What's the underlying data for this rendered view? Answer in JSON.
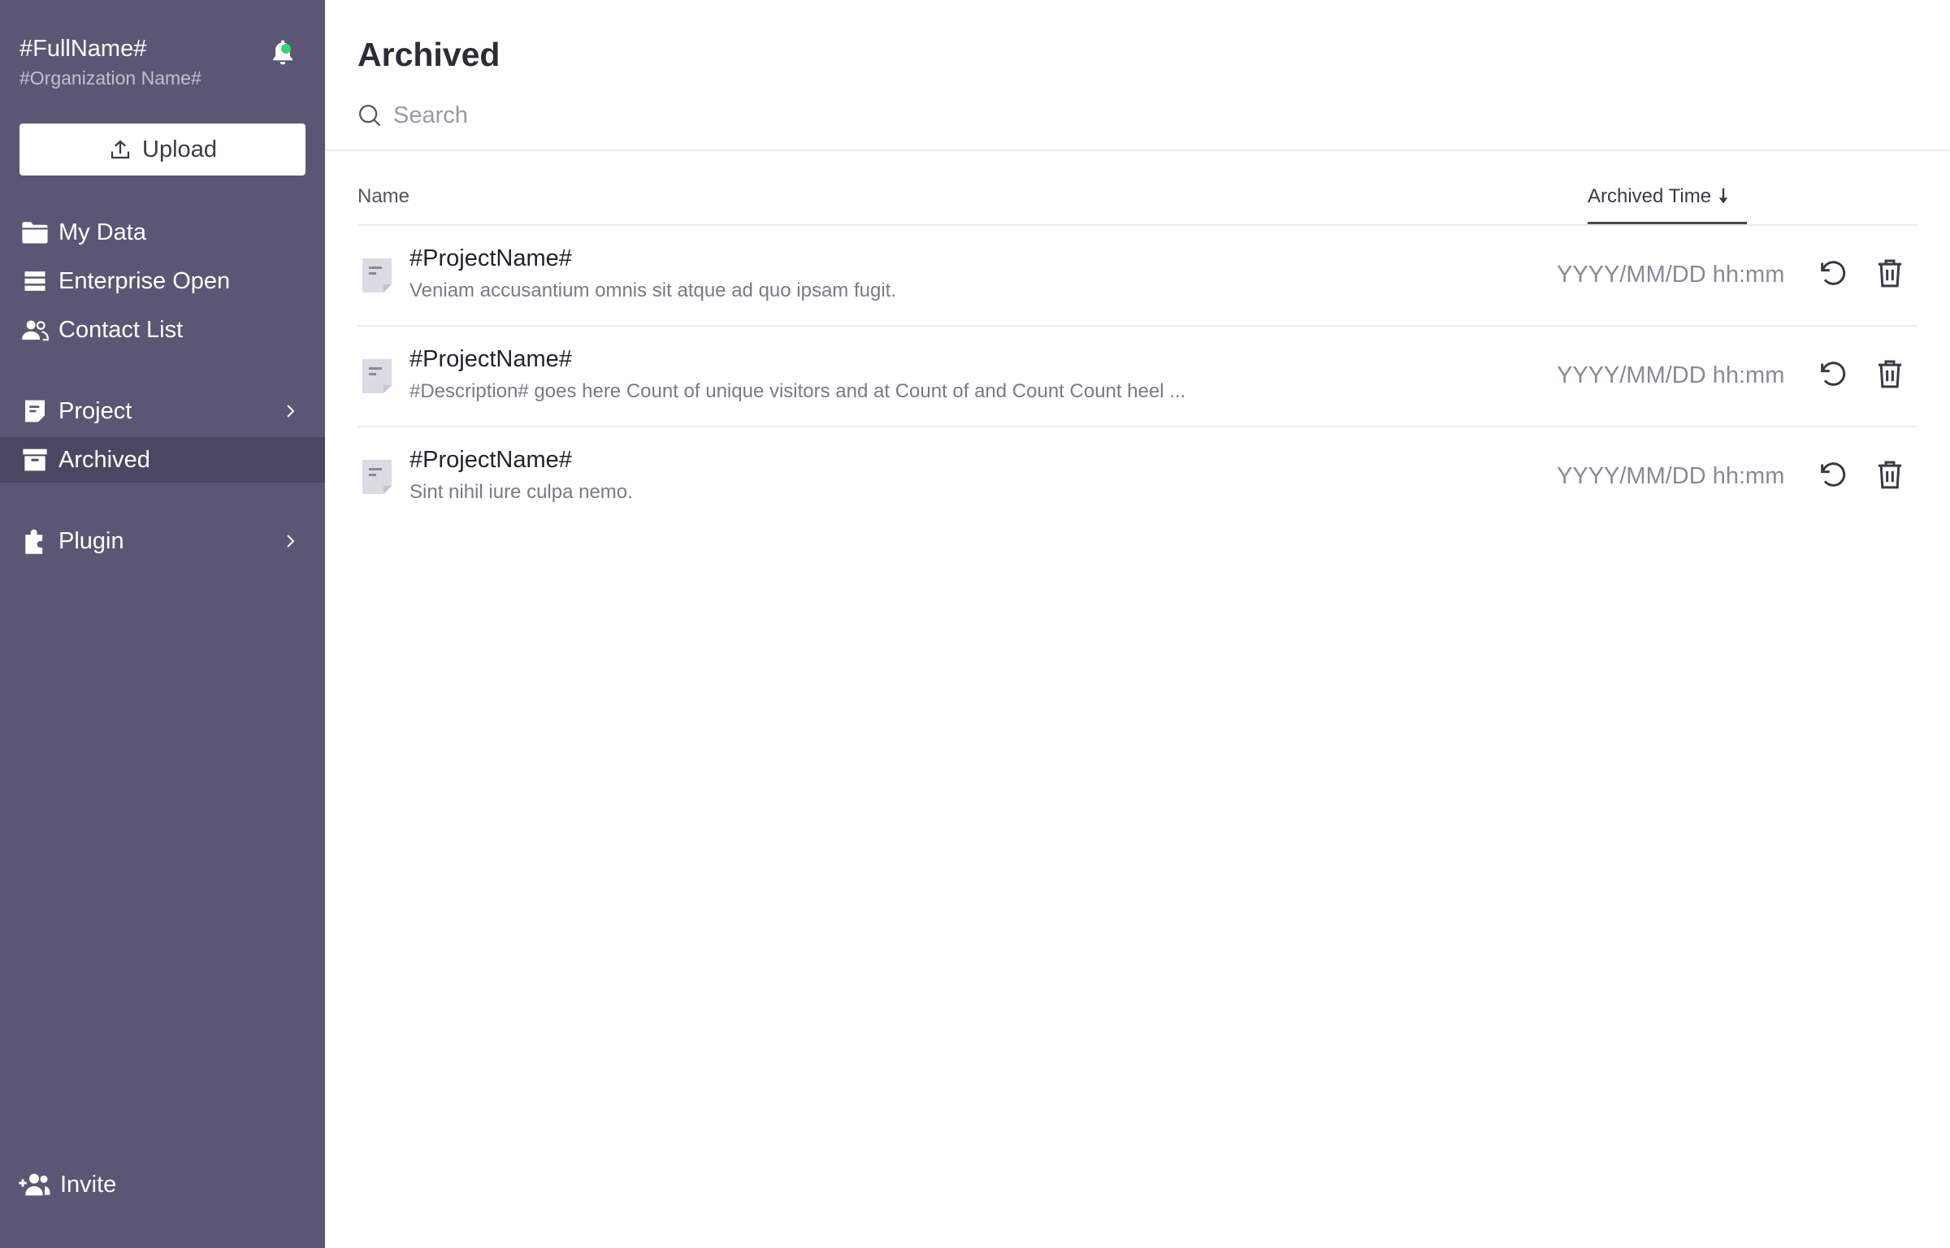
{
  "sidebar": {
    "user_name": "#FullName#",
    "org_name": "#Organization Name#",
    "upload_label": "Upload",
    "nav": {
      "my_data": "My Data",
      "enterprise_open": "Enterprise Open",
      "contact_list": "Contact List",
      "project": "Project",
      "archived": "Archived",
      "plugin": "Plugin"
    },
    "invite_label": "Invite",
    "active_item": "Archived",
    "notification_dot_color": "#36d27a"
  },
  "main": {
    "title": "Archived",
    "search": {
      "placeholder": "Search",
      "value": ""
    },
    "table": {
      "columns": {
        "name": "Name",
        "archived_time": "Archived Time",
        "sort_direction": "descending"
      },
      "rows": [
        {
          "name": "#ProjectName#",
          "description": "Veniam accusantium omnis sit atque ad quo ipsam fugit.",
          "time": "YYYY/MM/DD hh:mm"
        },
        {
          "name": "#ProjectName#",
          "description": "#Description# goes here Count of unique visitors and at Count of and Count Count heel ...",
          "time": "YYYY/MM/DD hh:mm"
        },
        {
          "name": "#ProjectName#",
          "description": "Sint nihil iure culpa nemo.",
          "time": "YYYY/MM/DD hh:mm"
        }
      ]
    }
  },
  "colors": {
    "sidebar_bg": "#5a5673",
    "sidebar_active_bg": "#4b4762"
  }
}
